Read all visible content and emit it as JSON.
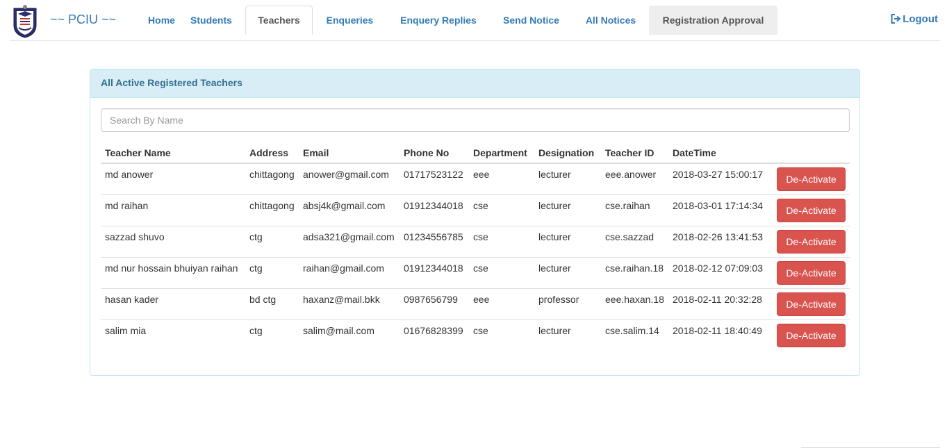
{
  "nav": {
    "brand": "~~ PCIU ~~",
    "items": [
      {
        "label": "Home"
      },
      {
        "label": "Students"
      },
      {
        "label": "Teachers"
      },
      {
        "label": "Enqueries"
      },
      {
        "label": "Enquery Replies"
      },
      {
        "label": "Send Notice"
      },
      {
        "label": "All Notices"
      },
      {
        "label": "Registration Approval"
      }
    ],
    "active": "Teachers",
    "logout_label": "Logout"
  },
  "panel": {
    "title": "All Active Registered Teachers",
    "search_placeholder": "Search By Name"
  },
  "table": {
    "headers": [
      "Teacher Name",
      "Address",
      "Email",
      "Phone No",
      "Department",
      "Designation",
      "Teacher ID",
      "DateTime"
    ],
    "action_label": "De-Activate",
    "rows": [
      {
        "name": "md anower",
        "address": "chittagong",
        "email": "anower@gmail.com",
        "phone": "01717523122",
        "department": "eee",
        "designation": "lecturer",
        "teacher_id": "eee.anower",
        "datetime": "2018-03-27 15:00:17"
      },
      {
        "name": "md raihan",
        "address": "chittagong",
        "email": "absj4k@gmail.com",
        "phone": "01912344018",
        "department": "cse",
        "designation": "lecturer",
        "teacher_id": "cse.raihan",
        "datetime": "2018-03-01 17:14:34"
      },
      {
        "name": "sazzad shuvo",
        "address": "ctg",
        "email": "adsa321@gmail.com",
        "phone": "01234556785",
        "department": "cse",
        "designation": "lecturer",
        "teacher_id": "cse.sazzad",
        "datetime": "2018-02-26 13:41:53"
      },
      {
        "name": "md nur hossain bhuiyan raihan",
        "address": "ctg",
        "email": "raihan@gmail.com",
        "phone": "01912344018",
        "department": "cse",
        "designation": "lecturer",
        "teacher_id": "cse.raihan.18",
        "datetime": "2018-02-12 07:09:03"
      },
      {
        "name": "hasan kader",
        "address": "bd ctg",
        "email": "haxanz@mail.bkk",
        "phone": "0987656799",
        "department": "eee",
        "designation": "professor",
        "teacher_id": "eee.haxan.18",
        "datetime": "2018-02-11 20:32:28"
      },
      {
        "name": "salim mia",
        "address": "ctg",
        "email": "salim@mail.com",
        "phone": "01676828399",
        "department": "cse",
        "designation": "lecturer",
        "teacher_id": "cse.salim.14",
        "datetime": "2018-02-11 18:40:49"
      }
    ]
  },
  "colors": {
    "link": "#337ab7",
    "panel_heading_bg": "#d9edf7",
    "panel_heading_text": "#31708f",
    "danger": "#d9534f"
  }
}
